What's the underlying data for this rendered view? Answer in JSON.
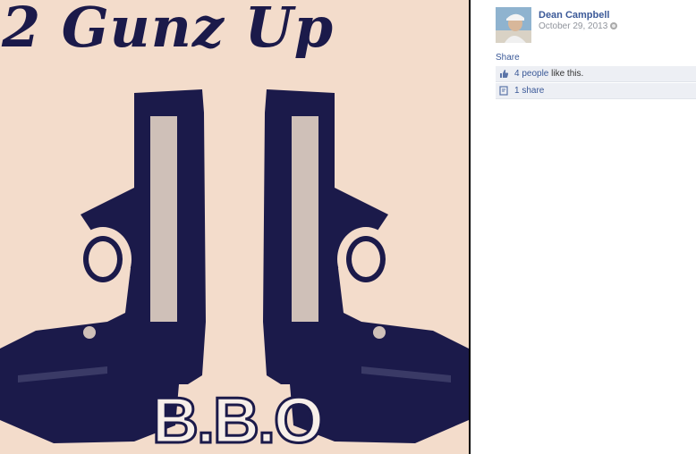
{
  "photo": {
    "title": "2 Gunz Up",
    "footer": "B.B.O",
    "colors": {
      "background": "#f3dccb",
      "ink": "#1b1a4a"
    }
  },
  "post": {
    "author": "Dean Campbell",
    "date": "October 29, 2013",
    "privacy_icon": "globe-icon"
  },
  "actions": {
    "share_label": "Share"
  },
  "ufi": {
    "likes_link": "4 people",
    "likes_suffix": " like this.",
    "likes_icon": "thumbs-up-icon",
    "shares_link": "1 share",
    "shares_icon": "share-icon"
  },
  "colors": {
    "link": "#3b5998",
    "ufi_bg": "#edeff4",
    "muted": "#90949c"
  }
}
